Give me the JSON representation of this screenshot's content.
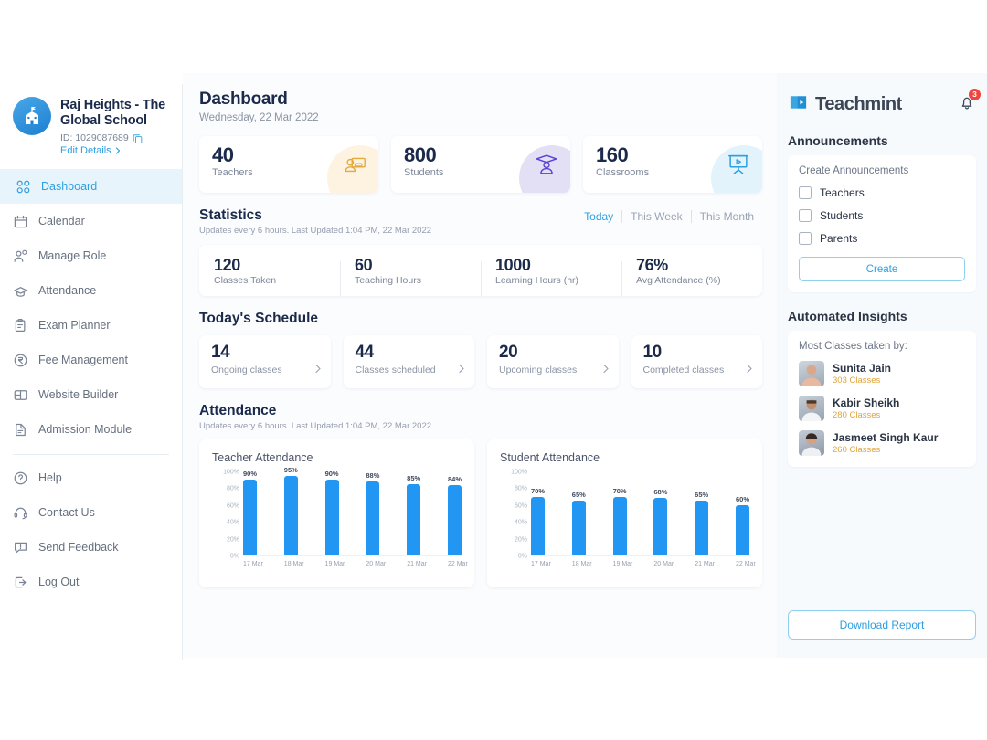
{
  "sidebar": {
    "school_name": "Raj Heights - The Global School",
    "school_id": "ID: 1029087689",
    "edit_details": "Edit Details",
    "items": [
      {
        "label": "Dashboard",
        "icon": "grid-icon",
        "active": true
      },
      {
        "label": "Calendar",
        "icon": "calendar-icon",
        "active": false
      },
      {
        "label": "Manage Role",
        "icon": "manage-role-icon",
        "active": false
      },
      {
        "label": "Attendance",
        "icon": "attendance-icon",
        "active": false
      },
      {
        "label": "Exam Planner",
        "icon": "clipboard-icon",
        "active": false
      },
      {
        "label": "Fee Management",
        "icon": "rupee-icon",
        "active": false
      },
      {
        "label": "Website Builder",
        "icon": "layout-icon",
        "active": false
      },
      {
        "label": "Admission Module",
        "icon": "document-icon",
        "active": false
      }
    ],
    "footer_items": [
      {
        "label": "Help",
        "icon": "help-icon"
      },
      {
        "label": "Contact Us",
        "icon": "headset-icon"
      },
      {
        "label": "Send Feedback",
        "icon": "feedback-icon"
      },
      {
        "label": "Log Out",
        "icon": "logout-icon"
      }
    ]
  },
  "main": {
    "title": "Dashboard",
    "date": "Wednesday, 22 Mar 2022",
    "kpis": [
      {
        "value": "40",
        "label": "Teachers",
        "icon": "teacher-icon",
        "blob": "#fdf3e0",
        "accent": "#e3a93c"
      },
      {
        "value": "800",
        "label": "Students",
        "icon": "student-icon",
        "blob": "#e8e5f8",
        "accent": "#5b3fd6"
      },
      {
        "value": "160",
        "label": "Classrooms",
        "icon": "classroom-icon",
        "blob": "#e3f3fb",
        "accent": "#2e9fe0"
      }
    ],
    "statistics": {
      "title": "Statistics",
      "subtitle": "Updates every 6 hours. Last Updated 1:04 PM, 22 Mar 2022",
      "filters": [
        {
          "label": "Today",
          "active": true
        },
        {
          "label": "This Week",
          "active": false
        },
        {
          "label": "This Month",
          "active": false
        }
      ],
      "cells": [
        {
          "value": "120",
          "label": "Classes Taken"
        },
        {
          "value": "60",
          "label": "Teaching Hours"
        },
        {
          "value": "1000",
          "label": "Learning Hours (hr)"
        },
        {
          "value": "76%",
          "label": "Avg Attendance (%)"
        }
      ]
    },
    "schedule": {
      "title": "Today's Schedule",
      "cards": [
        {
          "value": "14",
          "label": "Ongoing classes"
        },
        {
          "value": "44",
          "label": "Classes scheduled"
        },
        {
          "value": "20",
          "label": "Upcoming classes"
        },
        {
          "value": "10",
          "label": "Completed classes"
        }
      ]
    },
    "attendance": {
      "title": "Attendance",
      "subtitle": "Updates every 6 hours. Last Updated 1:04 PM, 22 Mar 2022"
    }
  },
  "chart_data": [
    {
      "type": "bar",
      "title": "Teacher Attendance",
      "categories": [
        "17 Mar",
        "18 Mar",
        "19 Mar",
        "20 Mar",
        "21 Mar",
        "22 Mar"
      ],
      "values": [
        90,
        95,
        90,
        88,
        85,
        84
      ],
      "value_labels": [
        "90%",
        "95%",
        "90%",
        "88%",
        "85%",
        "84%"
      ],
      "yticks": [
        "100%",
        "80%",
        "60%",
        "40%",
        "20%",
        "0%"
      ],
      "ylim": [
        0,
        100
      ],
      "xlabel": "",
      "ylabel": "",
      "grid": false,
      "legend": "none",
      "bar_color": "#2196f3"
    },
    {
      "type": "bar",
      "title": "Student Attendance",
      "categories": [
        "17 Mar",
        "18 Mar",
        "19 Mar",
        "20 Mar",
        "21 Mar",
        "22 Mar"
      ],
      "values": [
        70,
        65,
        70,
        68,
        65,
        60
      ],
      "value_labels": [
        "70%",
        "65%",
        "70%",
        "68%",
        "65%",
        "60%"
      ],
      "yticks": [
        "100%",
        "80%",
        "60%",
        "40%",
        "20%",
        "0%"
      ],
      "ylim": [
        0,
        100
      ],
      "xlabel": "",
      "ylabel": "",
      "grid": false,
      "legend": "none",
      "bar_color": "#2196f3"
    }
  ],
  "right": {
    "brand": "Teachmint",
    "notification_count": "3",
    "announcements": {
      "title": "Announcements",
      "subtitle": "Create Announcements",
      "options": [
        "Teachers",
        "Students",
        "Parents"
      ],
      "button": "Create"
    },
    "insights": {
      "title": "Automated Insights",
      "subtitle": "Most Classes taken by:",
      "people": [
        {
          "name": "Sunita Jain",
          "classes": "303 Classes",
          "av1": "#d9a88c",
          "av2": "#8fa2b5"
        },
        {
          "name": "Kabir Sheikh",
          "classes": "280 Classes",
          "av1": "#6b5244",
          "av2": "#9aa7b3"
        },
        {
          "name": "Jasmeet Singh Kaur",
          "classes": "260 Classes",
          "av1": "#c49a80",
          "av2": "#8d98a6"
        }
      ]
    },
    "download_button": "Download Report"
  }
}
